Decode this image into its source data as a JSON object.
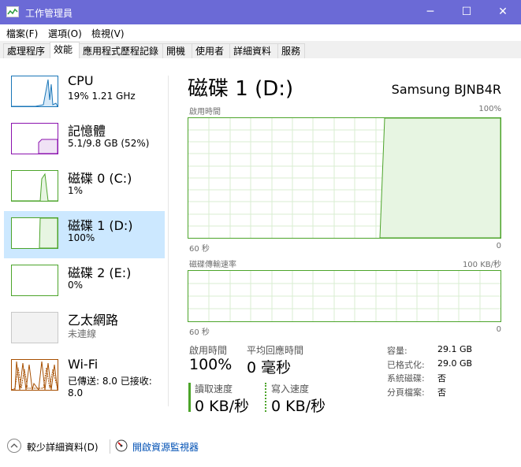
{
  "window": {
    "title": "工作管理員",
    "controls": {
      "minimize": "─",
      "maximize": "☐",
      "close": "✕"
    }
  },
  "menu": [
    "檔案(F)",
    "選項(O)",
    "檢視(V)"
  ],
  "tabs": [
    "處理程序",
    "效能",
    "應用程式歷程記錄",
    "開機",
    "使用者",
    "詳細資料",
    "服務"
  ],
  "sidebar": [
    {
      "title": "CPU",
      "subtitle": "19% 1.21 GHz",
      "color": "#1a76b8"
    },
    {
      "title": "記憶體",
      "subtitle": "5.1/9.8 GB (52%)",
      "color": "#8b12ae"
    },
    {
      "title": "磁碟 0 (C:)",
      "subtitle": "1%",
      "color": "#4ca42a"
    },
    {
      "title": "磁碟 1 (D:)",
      "subtitle": "100%",
      "color": "#4ca42a"
    },
    {
      "title": "磁碟 2 (E:)",
      "subtitle": "0%",
      "color": "#4ca42a"
    },
    {
      "title": "乙太網路",
      "subtitle": "未連線",
      "color": "#a0a0a0"
    },
    {
      "title": "Wi-Fi",
      "subtitle": "已傳送: 8.0  已接收: 8.0",
      "color": "#a74f01"
    }
  ],
  "main": {
    "title": "磁碟 1 (D:)",
    "model": "Samsung BJNB4R",
    "graph1": {
      "label": "啟用時間",
      "max": "100%",
      "time": "60 秒",
      "zero": "0"
    },
    "graph2": {
      "label": "磁碟傳輸速率",
      "max": "100 KB/秒",
      "time": "60 秒",
      "zero": "0"
    },
    "stats": {
      "active_time_label": "啟用時間",
      "active_time": "100%",
      "avg_response_label": "平均回應時間",
      "avg_response": "0 毫秒",
      "read_label": "讀取速度",
      "read": "0 KB/秒",
      "write_label": "寫入速度",
      "write": "0 KB/秒"
    },
    "properties": [
      {
        "label": "容量:",
        "value": "29.1 GB"
      },
      {
        "label": "已格式化:",
        "value": "29.0 GB"
      },
      {
        "label": "系統磁碟:",
        "value": "否"
      },
      {
        "label": "分頁檔案:",
        "value": "否"
      }
    ]
  },
  "footer": {
    "fewer_details": "較少詳細資料(D)",
    "open_monitor": "開啟資源監視器"
  },
  "colors": {
    "titlebar": "#6b6ad6",
    "selected": "#cce8ff",
    "disk_green": "#4ca42a"
  }
}
